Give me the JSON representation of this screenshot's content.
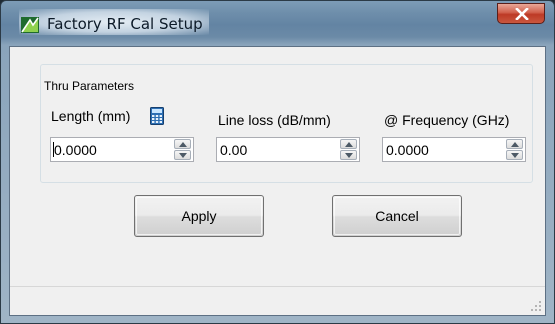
{
  "window": {
    "title": "Factory RF Cal Setup"
  },
  "group": {
    "caption": "Thru Parameters"
  },
  "fields": {
    "length": {
      "label": "Length (mm)",
      "value": "0.0000"
    },
    "line_loss": {
      "label": "Line loss (dB/mm)",
      "value": "0.00"
    },
    "frequency": {
      "label": "@ Frequency (GHz)",
      "value": "0.0000"
    }
  },
  "buttons": {
    "apply": "Apply",
    "cancel": "Cancel"
  },
  "icons": {
    "app": "app-icon",
    "calculator": "calculator-icon",
    "close": "close-icon",
    "resize_grip": "resize-grip-icon"
  },
  "colors": {
    "close_button": "#c4432d",
    "titlebar": "#6e8eab",
    "client_bg": "#f0f0f0"
  }
}
